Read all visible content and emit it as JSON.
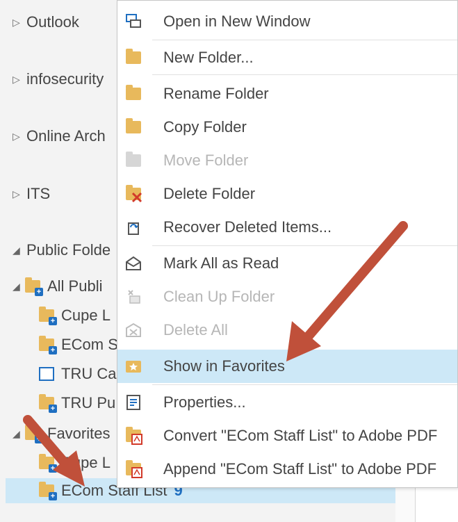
{
  "nav": {
    "outlook": "Outlook",
    "infosecurity": "infosecurity",
    "online_archive": "Online Arch",
    "its": "ITS",
    "public_folders": "Public Folde",
    "all_public": "All Publi",
    "cupe": "Cupe L",
    "ecom_s": "ECom S",
    "tru_ca": "TRU Ca",
    "tru_pu": "TRU Pu",
    "favorites": "Favorites",
    "fav_cupe": "Cupe L",
    "ecom_staff_list": "ECom Staff List",
    "ecom_staff_count": "9"
  },
  "menu": {
    "open_new_window": "Open in New Window",
    "new_folder": "New Folder...",
    "rename_folder": "Rename Folder",
    "copy_folder": "Copy Folder",
    "move_folder": "Move Folder",
    "delete_folder": "Delete Folder",
    "recover_deleted": "Recover Deleted Items...",
    "mark_all_read": "Mark All as Read",
    "clean_up_folder": "Clean Up Folder",
    "delete_all": "Delete All",
    "show_in_favorites": "Show in Favorites",
    "properties": "Properties...",
    "convert_pdf": "Convert \"ECom Staff List\" to Adobe PDF",
    "append_pdf": "Append \"ECom Staff List\" to Adobe PDF"
  },
  "colors": {
    "highlight": "#cde8f7",
    "arrow": "#c0503a",
    "folder": "#e8b95c",
    "accent": "#1f6fc1"
  }
}
